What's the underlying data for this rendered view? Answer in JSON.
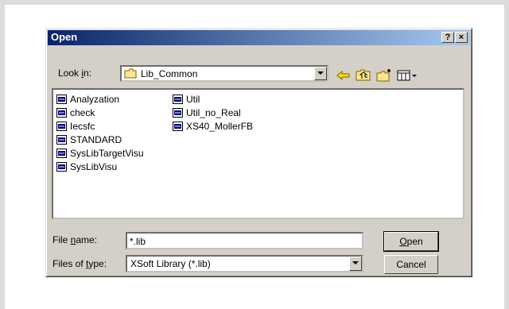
{
  "dialog": {
    "title": "Open",
    "help_button": "?",
    "close_button": "×"
  },
  "look_in": {
    "label_pre": "Look ",
    "label_key": "i",
    "label_post": "n:",
    "value": "Lib_Common"
  },
  "files": [
    {
      "name": "Analyzation"
    },
    {
      "name": "check"
    },
    {
      "name": "Iecsfc"
    },
    {
      "name": "STANDARD"
    },
    {
      "name": "SysLibTargetVisu"
    },
    {
      "name": "SysLibVisu"
    },
    {
      "name": "Util"
    },
    {
      "name": "Util_no_Real"
    },
    {
      "name": "XS40_MollerFB"
    }
  ],
  "file_name": {
    "label_pre": "File ",
    "label_key": "n",
    "label_post": "ame:",
    "value": "*.lib"
  },
  "files_of_type": {
    "label_pre": "Files of ",
    "label_key": "t",
    "label_post": "ype:",
    "value": "XSoft Library (*.lib)"
  },
  "buttons": {
    "open_key": "O",
    "open_rest": "pen",
    "cancel": "Cancel"
  },
  "colors": {
    "titlebar_start": "#0a246a",
    "titlebar_end": "#a6caf0",
    "face": "#d4d0c8"
  }
}
